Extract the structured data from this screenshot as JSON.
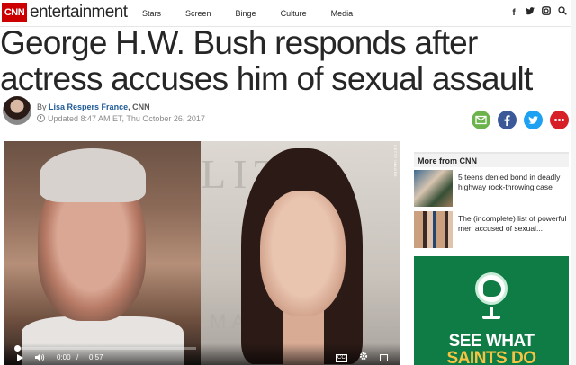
{
  "header": {
    "logo": "CNN",
    "section": "entertainment",
    "nav": [
      "Stars",
      "Screen",
      "Binge",
      "Culture",
      "Media"
    ],
    "social": [
      "facebook-icon",
      "twitter-icon",
      "instagram-icon",
      "search-icon"
    ]
  },
  "article": {
    "headline": "George H.W. Bush responds after actress accuses him of sexual assault",
    "by": "By",
    "author": "Lisa Respers France",
    "org": ", CNN",
    "updated": "Updated 8:47 AM ET, Thu October 26, 2017"
  },
  "share": {
    "colors": {
      "email": "#6cb34b",
      "facebook": "#3b5998",
      "twitter": "#1da1f2",
      "more": "#d61f26"
    }
  },
  "video": {
    "credit": "GETTY IMAGES",
    "bg_text": "LIT",
    "bg_text_lower": "MA",
    "time_current": "0:00",
    "time_sep": "/",
    "time_duration": "0:57",
    "progress": 0.0,
    "cc": "CC"
  },
  "sidebar": {
    "title": "More from CNN",
    "items": [
      {
        "text": "5 teens denied bond in deadly highway rock-throwing case"
      },
      {
        "text": "The (incomplete) list of powerful men accused of sexual..."
      }
    ]
  },
  "ad": {
    "line1": "SEE WHAT",
    "line2": "SAINTS DO"
  }
}
